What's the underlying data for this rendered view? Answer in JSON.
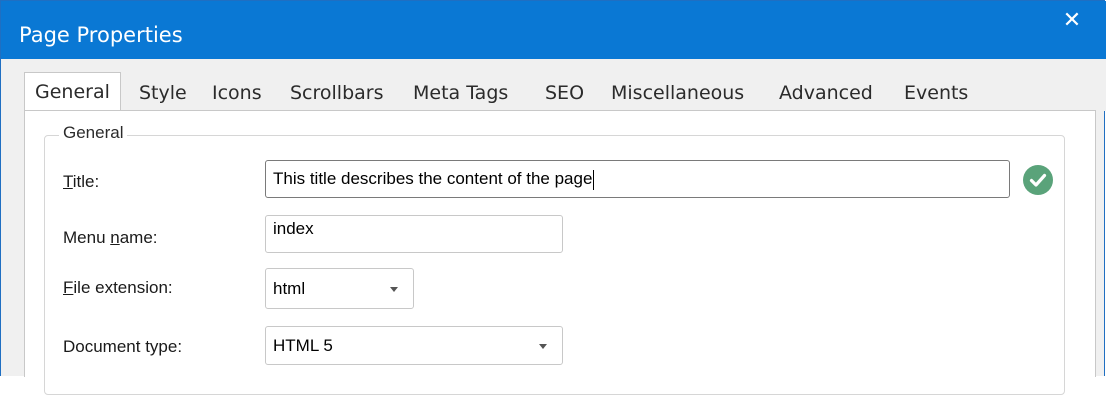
{
  "dialog": {
    "title": "Page Properties",
    "close_glyph": "✕"
  },
  "tabs": [
    {
      "label": "General",
      "active": true
    },
    {
      "label": "Style"
    },
    {
      "label": "Icons"
    },
    {
      "label": "Scrollbars"
    },
    {
      "label": "Meta Tags"
    },
    {
      "label": "SEO"
    },
    {
      "label": "Miscellaneous"
    },
    {
      "label": "Advanced"
    },
    {
      "label": "Events"
    }
  ],
  "group": {
    "legend": "General"
  },
  "fields": {
    "title": {
      "label_prefix": "",
      "label_accel": "T",
      "label_suffix": "itle:",
      "value": "This title describes the content of the page",
      "valid": true
    },
    "menu_name": {
      "label_prefix": "Menu ",
      "label_accel": "n",
      "label_suffix": "ame:",
      "value": "index"
    },
    "file_extension": {
      "label_prefix": "",
      "label_accel": "F",
      "label_suffix": "ile extension:",
      "value": "html"
    },
    "document_type": {
      "label": "Document type:",
      "value": "HTML 5"
    }
  },
  "colors": {
    "titlebar": "#0a78d4",
    "valid_icon": "#5aa37a"
  }
}
